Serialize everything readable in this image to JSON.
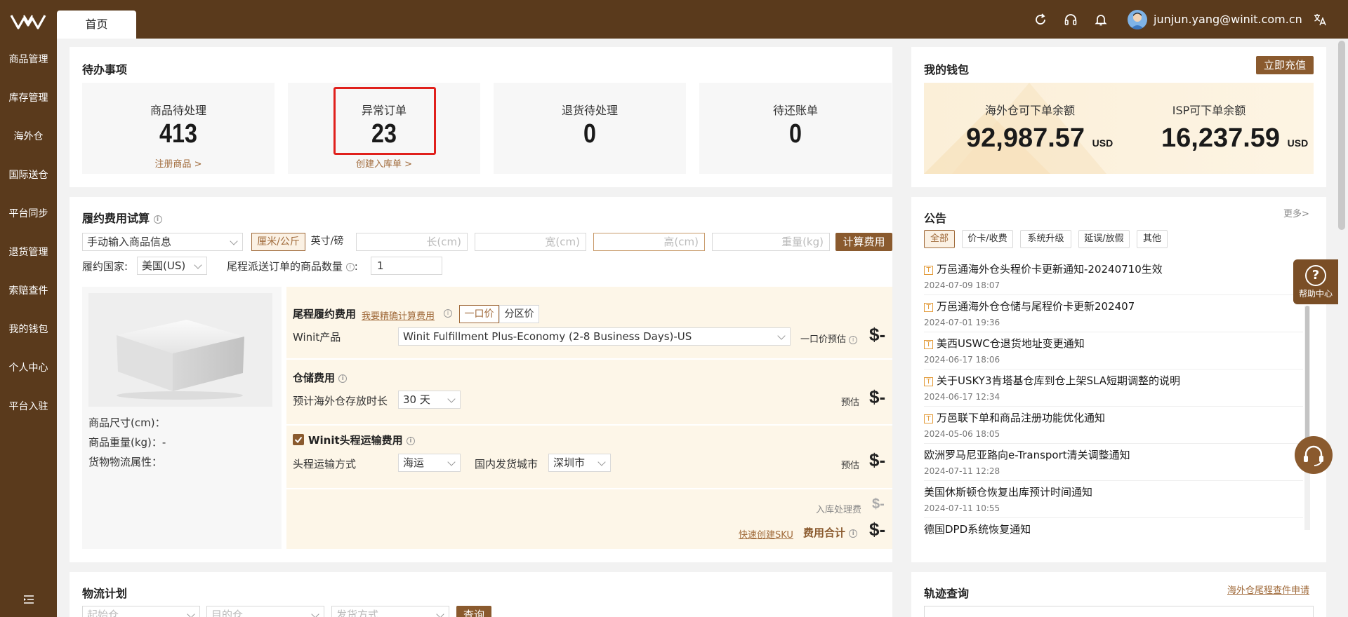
{
  "app": {
    "home_tab": "首页",
    "user_email": "junjun.yang@winit.com.cn"
  },
  "sidebar": {
    "items": [
      "商品管理",
      "库存管理",
      "海外仓",
      "国际送仓",
      "平台同步",
      "退货管理",
      "索赔查件",
      "我的钱包",
      "个人中心",
      "平台入驻"
    ]
  },
  "todo": {
    "title": "待办事项",
    "cards": [
      {
        "label": "商品待处理",
        "value": "413",
        "link": "注册商品 >"
      },
      {
        "label": "异常订单",
        "value": "23",
        "link": "创建入库单 >"
      },
      {
        "label": "退货待处理",
        "value": "0",
        "link": ""
      },
      {
        "label": "待还账单",
        "value": "0",
        "link": ""
      }
    ]
  },
  "wallet": {
    "title": "我的钱包",
    "recharge_label": "立即充值",
    "overseas_label": "海外仓可下单余额",
    "overseas_amount": "92,987.57",
    "overseas_unit": "USD",
    "isp_label": "ISP可下单余额",
    "isp_amount": "16,237.59",
    "isp_unit": "USD"
  },
  "fee_calc": {
    "title": "履约费用试算",
    "product_input_mode": "手动输入商品信息",
    "unit_metric": "厘米/公斤",
    "unit_imperial": "英寸/磅",
    "length_placeholder": "长(cm)",
    "width_placeholder": "宽(cm)",
    "height_placeholder": "高(cm)",
    "weight_placeholder": "重量(kg)",
    "calc_button": "计算费用",
    "country_label": "履约国家:",
    "country_value": "美国(US)",
    "qty_label": "尾程派送订单的商品数量",
    "qty_value": "1",
    "product_size": "商品尺寸(cm)：",
    "product_weight": "商品重量(kg)：-",
    "product_attr": "货物物流属性：",
    "last_mile_title": "尾程履约费用",
    "precise_link": "我要精确计算费用",
    "flat_price": "一口价",
    "zone_price": "分区价",
    "winit_product_label": "Winit产品",
    "winit_product_value": "Winit Fulfillment Plus-Economy (2-8 Business Days)-US",
    "flat_estimate": "一口价预估",
    "storage_title": "仓储费用",
    "storage_duration_label": "预计海外仓存放时长",
    "storage_duration_value": "30 天",
    "estimate": "预估",
    "headhaul_title": "Winit头程运输费用",
    "headhaul_method_label": "头程运输方式",
    "headhaul_method_value": "海运",
    "city_label": "国内发货城市",
    "city_value": "深圳市",
    "inbound_fee": "入库处理费",
    "quick_sku": "快速创建SKU",
    "total_fee": "费用合计",
    "dollar_placeholder": "$-"
  },
  "announcements": {
    "title": "公告",
    "more": "更多>",
    "tags": [
      "全部",
      "价卡/收费",
      "系统升级",
      "延误/放假",
      "其他"
    ],
    "items": [
      {
        "title": "万邑通海外仓头程价卡更新通知-20240710生效",
        "date": "2024-07-09 18:07",
        "top": true
      },
      {
        "title": "万邑通海外仓仓储与尾程价卡更新202407",
        "date": "2024-07-01 19:36",
        "top": true
      },
      {
        "title": "美西USWC仓退货地址变更通知",
        "date": "2024-06-17 18:06",
        "top": true
      },
      {
        "title": "关于USKY3肯塔基仓库到仓上架SLA短期调整的说明",
        "date": "2024-06-17 12:34",
        "top": true
      },
      {
        "title": "万邑联下单和商品注册功能优化通知",
        "date": "2024-05-06 18:05",
        "top": true
      },
      {
        "title": "欧洲罗马尼亚路向e-Transport清关调整通知",
        "date": "2024-07-11 12:28",
        "top": false
      },
      {
        "title": "美国休斯顿仓恢复出库预计时间通知",
        "date": "2024-07-11 10:55",
        "top": false
      },
      {
        "title": "德国DPD系统恢复通知",
        "date": "",
        "top": false
      }
    ],
    "top_marker": "T"
  },
  "help": {
    "label": "帮助中心",
    "symbol": "?"
  },
  "logistics": {
    "title": "物流计划",
    "origin_placeholder": "起始仓",
    "dest_placeholder": "目的仓",
    "method_placeholder": "发货方式",
    "query_button": "查询"
  },
  "tracking": {
    "title": "轨迹查询",
    "link": "海外仓尾程查件申请"
  },
  "colors": {
    "brand_brown": "#5a3a1c",
    "button_brown": "#8a5a2e",
    "accent_link": "#a06a3a",
    "highlight_red": "#e0201c"
  }
}
